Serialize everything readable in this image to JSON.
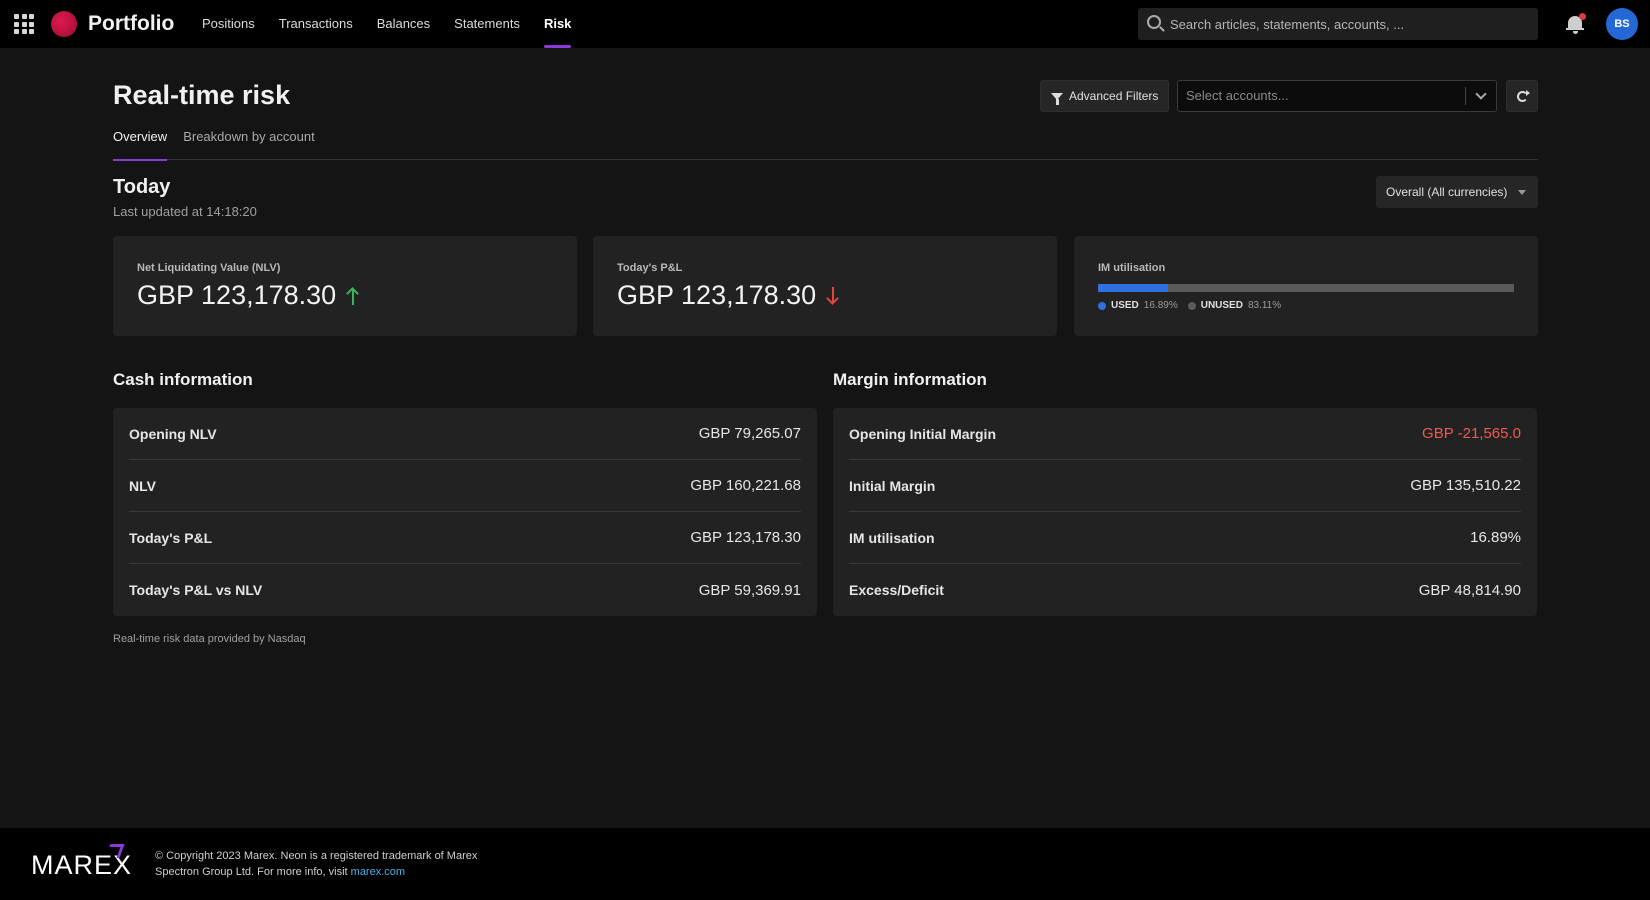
{
  "header": {
    "brand": "Portfolio",
    "nav": [
      {
        "label": "Positions",
        "active": false
      },
      {
        "label": "Transactions",
        "active": false
      },
      {
        "label": "Balances",
        "active": false
      },
      {
        "label": "Statements",
        "active": false
      },
      {
        "label": "Risk",
        "active": true
      }
    ],
    "search_placeholder": "Search articles, statements, accounts, ...",
    "avatar_initials": "BS",
    "colors": {
      "accent": "#8a3ad6",
      "logo": "#e0194f",
      "avatar": "#2468d6"
    }
  },
  "page": {
    "title": "Real-time risk",
    "advanced_filters_label": "Advanced Filters",
    "account_select_placeholder": "Select accounts...",
    "tabs": [
      {
        "label": "Overview",
        "active": true
      },
      {
        "label": "Breakdown by account",
        "active": false
      }
    ],
    "section_title": "Today",
    "last_updated_prefix": "Last updated at",
    "last_updated_time": "14:18:20",
    "currency_select_value": "Overall (All currencies)"
  },
  "kpis": {
    "nlv": {
      "label": "Net Liquidating Value (NLV)",
      "value": "GBP 123,178.30",
      "trend": "up"
    },
    "pnl": {
      "label": "Today's P&L",
      "value": "GBP 123,178.30",
      "trend": "down"
    },
    "im": {
      "label": "IM utilisation",
      "used_fraction": 0.1689,
      "used_label": "USED",
      "used_value": "16.89%",
      "unused_label": "UNUSED",
      "unused_value": "83.11%",
      "colors": {
        "used": "#2f6fde",
        "unused": "#5a5a5a"
      }
    }
  },
  "cash": {
    "title": "Cash information",
    "rows": [
      {
        "label": "Opening NLV",
        "value": "GBP 79,265.07"
      },
      {
        "label": "NLV",
        "value": "GBP 160,221.68"
      },
      {
        "label": "Today's P&L",
        "value": "GBP 123,178.30"
      },
      {
        "label": "Today's P&L vs NLV",
        "value": "GBP 59,369.91"
      }
    ]
  },
  "margin": {
    "title": "Margin information",
    "rows": [
      {
        "label": "Opening Initial Margin",
        "value": "GBP -21,565.0",
        "negative": true
      },
      {
        "label": "Initial Margin",
        "value": "GBP 135,510.22"
      },
      {
        "label": "IM utilisation",
        "value": "16.89%"
      },
      {
        "label": "Excess/Deficit",
        "value": "GBP 48,814.90"
      }
    ]
  },
  "source_note": "Real-time risk data provided by Nasdaq",
  "footer": {
    "logo_text": "MAREX",
    "copyright_line1": "© Copyright 2023 Marex. Neon is a registered trademark of Marex",
    "copyright_line2": "Spectron Group Ltd. For more info, visit",
    "link_text": "marex.com"
  }
}
